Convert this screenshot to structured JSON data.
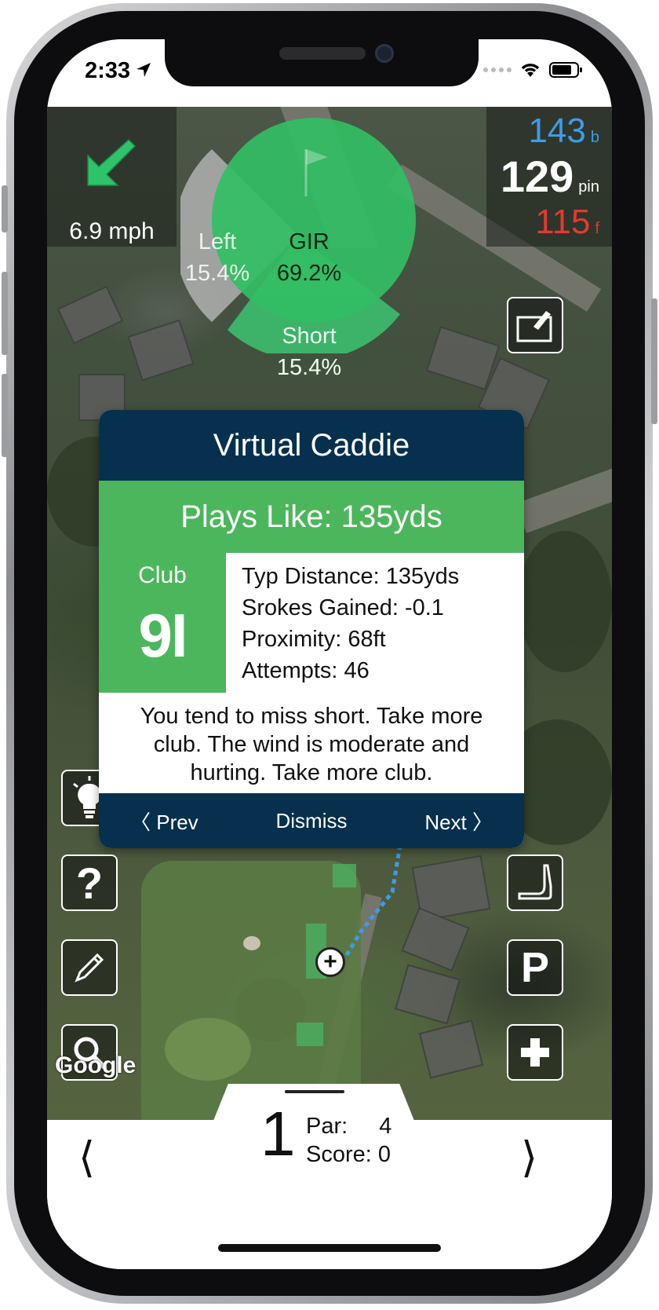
{
  "status_bar": {
    "time": "2:33"
  },
  "wind": {
    "speed": "6.9 mph"
  },
  "distances": {
    "back": {
      "value": "143",
      "suffix": "b"
    },
    "pin": {
      "value": "129",
      "suffix": "pin"
    },
    "front": {
      "value": "115",
      "suffix": "f"
    }
  },
  "gir_stats": {
    "gir": {
      "label": "GIR",
      "value": "69.2%"
    },
    "left": {
      "label": "Left",
      "value": "15.4%"
    },
    "short": {
      "label": "Short",
      "value": "15.4%"
    }
  },
  "map": {
    "attribution": "Google"
  },
  "caddie": {
    "title": "Virtual Caddie",
    "plays_like": "Plays Like: 135yds",
    "club_label": "Club",
    "club_value": "9I",
    "stats": [
      "Typ Distance: 135yds",
      "Srokes Gained: -0.1",
      "Proximity: 68ft",
      "Attempts: 46"
    ],
    "advice": "You tend to miss short. Take more club. The wind is moderate and hurting. Take more club.",
    "prev_label": "〈 Prev",
    "dismiss_label": "Dismiss",
    "next_label": "Next 〉"
  },
  "hole": {
    "number": "1",
    "par_label": "Par:",
    "par_value": "4",
    "score_label": "Score:",
    "score_value": "0",
    "prev_arrow": "⟨",
    "next_arrow": "⟩"
  },
  "colors": {
    "navy": "#06304e",
    "green": "#4cb65c",
    "back_distance": "#3f9be8",
    "front_distance": "#e53a2b"
  }
}
